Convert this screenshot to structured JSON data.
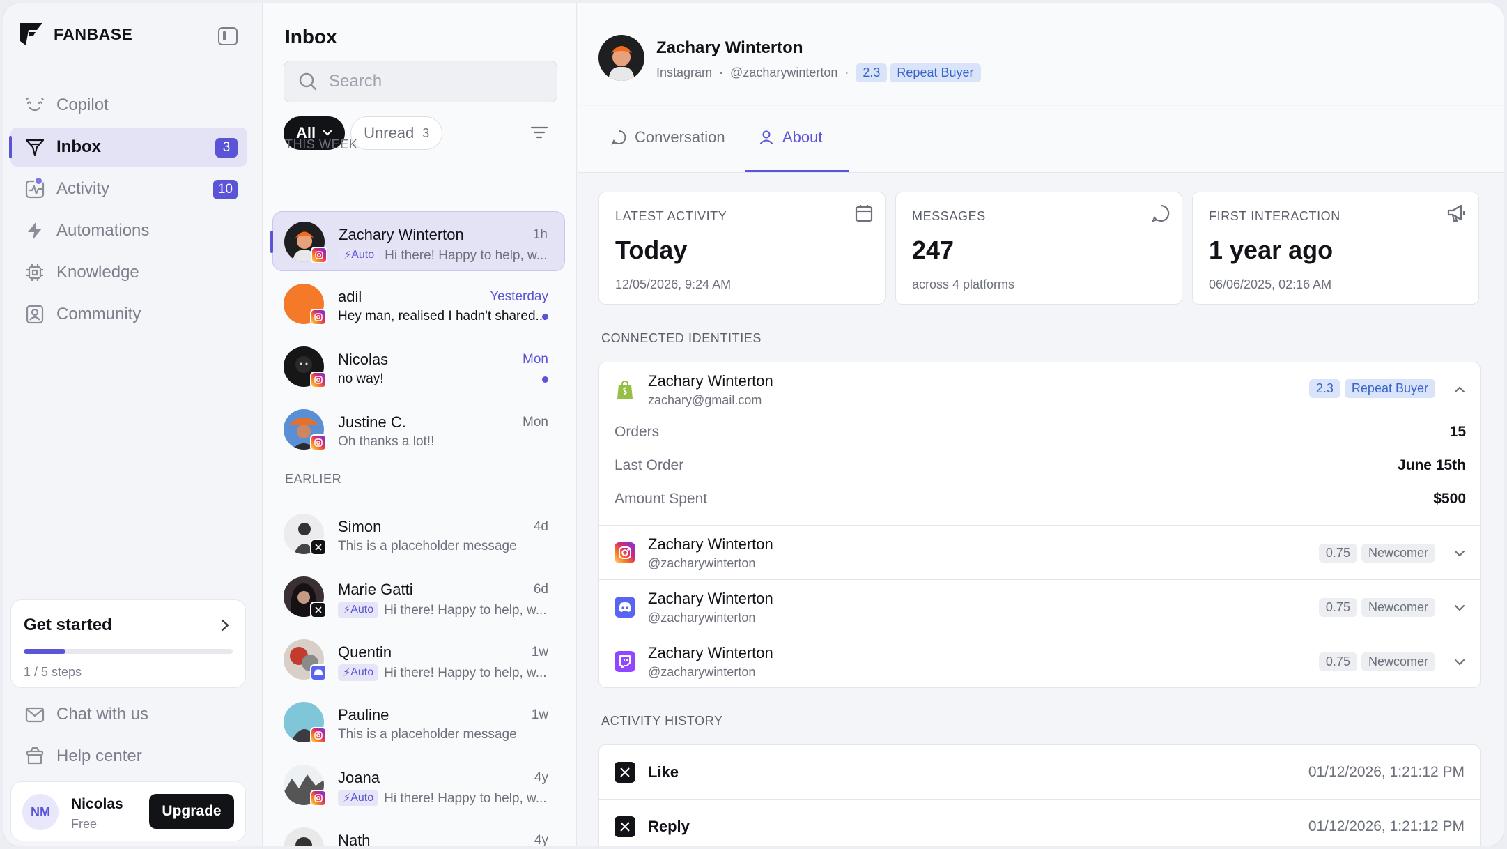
{
  "brand": {
    "name": "FANBASE"
  },
  "nav": [
    {
      "label": "Copilot",
      "icon": "copilot-icon"
    },
    {
      "label": "Inbox",
      "icon": "inbox-icon",
      "badge": "3",
      "active": true
    },
    {
      "label": "Activity",
      "icon": "activity-icon",
      "badge": "10"
    },
    {
      "label": "Automations",
      "icon": "lightning-icon"
    },
    {
      "label": "Knowledge",
      "icon": "chip-icon"
    },
    {
      "label": "Community",
      "icon": "community-icon"
    }
  ],
  "get_started": {
    "title": "Get started",
    "steps": "1 / 5 steps",
    "progress": 0.2
  },
  "bottom_links": [
    {
      "label": "Chat with us",
      "icon": "mail-icon"
    },
    {
      "label": "Help center",
      "icon": "help-icon"
    }
  ],
  "user": {
    "initials": "NM",
    "name": "Nicolas",
    "plan": "Free",
    "upgrade_label": "Upgrade"
  },
  "inbox": {
    "title": "Inbox",
    "search_placeholder": "Search",
    "filter_all": "All",
    "filter_unread": "Unread",
    "unread_count": "3",
    "section_this_week": "THIS WEEK",
    "section_earlier": "EARLIER",
    "auto_label": "Auto",
    "conversations": [
      {
        "name": "Zachary Winterton",
        "time": "1h",
        "preview": "Hi there! Happy to help, w...",
        "auto": true,
        "platform": "instagram",
        "selected": true
      },
      {
        "name": "adil",
        "time": "Yesterday",
        "preview": "Hey man, realised I hadn't shared...",
        "platform": "instagram",
        "unread": true
      },
      {
        "name": "Nicolas",
        "time": "Mon",
        "preview": "no way!",
        "platform": "instagram",
        "unread": true
      },
      {
        "name": "Justine C.",
        "time": "Mon",
        "preview": "Oh thanks a lot!!",
        "platform": "instagram"
      },
      {
        "name": "Simon",
        "time": "4d",
        "preview": "This is a placeholder message",
        "platform": "x"
      },
      {
        "name": "Marie Gatti",
        "time": "6d",
        "preview": "Hi there! Happy to help, w...",
        "auto": true,
        "platform": "x"
      },
      {
        "name": "Quentin",
        "time": "1w",
        "preview": "Hi there! Happy to help, w...",
        "auto": true,
        "platform": "discord"
      },
      {
        "name": "Pauline",
        "time": "1w",
        "preview": "This is a placeholder message",
        "platform": "instagram"
      },
      {
        "name": "Joana",
        "time": "4y",
        "preview": "Hi there! Happy to help, w...",
        "auto": true,
        "platform": "instagram"
      },
      {
        "name": "Nath",
        "time": "4y",
        "preview": "",
        "platform": "instagram"
      }
    ]
  },
  "contact": {
    "name": "Zachary Winterton",
    "platform": "Instagram",
    "handle": "@zacharywinterton",
    "score": "2.3",
    "segment": "Repeat Buyer"
  },
  "tabs": {
    "conversation": "Conversation",
    "about": "About"
  },
  "stats": [
    {
      "label": "LATEST ACTIVITY",
      "value": "Today",
      "sub": "12/05/2026, 9:24 AM",
      "icon": "calendar-icon"
    },
    {
      "label": "MESSAGES",
      "value": "247",
      "sub": "across 4 platforms",
      "icon": "chat-bubble-icon"
    },
    {
      "label": "FIRST INTERACTION",
      "value": "1 year ago",
      "sub": "06/06/2025, 02:16 AM",
      "icon": "megaphone-icon"
    }
  ],
  "identities_title": "CONNECTED IDENTITIES",
  "identities": [
    {
      "platform": "shopify",
      "name": "Zachary Winterton",
      "handle": "zachary@gmail.com",
      "score": "2.3",
      "segment": "Repeat Buyer",
      "expanded": true,
      "details": [
        {
          "k": "Orders",
          "v": "15"
        },
        {
          "k": "Last Order",
          "v": "June 15th"
        },
        {
          "k": "Amount Spent",
          "v": "$500"
        }
      ]
    },
    {
      "platform": "instagram",
      "name": "Zachary Winterton",
      "handle": "@zacharywinterton",
      "score": "0.75",
      "segment": "Newcomer"
    },
    {
      "platform": "discord",
      "name": "Zachary Winterton",
      "handle": "@zacharywinterton",
      "score": "0.75",
      "segment": "Newcomer"
    },
    {
      "platform": "twitch",
      "name": "Zachary Winterton",
      "handle": "@zacharywinterton",
      "score": "0.75",
      "segment": "Newcomer"
    }
  ],
  "history_title": "ACTIVITY HISTORY",
  "history": [
    {
      "platform": "x",
      "label": "Like",
      "time": "01/12/2026, 1:21:12 PM"
    },
    {
      "platform": "x",
      "label": "Reply",
      "time": "01/12/2026, 1:21:12 PM"
    }
  ],
  "colors": {
    "accent": "#5b54d6",
    "accent_soft": "#e4e3f5",
    "score_blue": "#3a64c8",
    "instagram": "#dd2a7b",
    "discord": "#5865f2",
    "twitch": "#9146ff",
    "shopify": "#95bf47"
  }
}
